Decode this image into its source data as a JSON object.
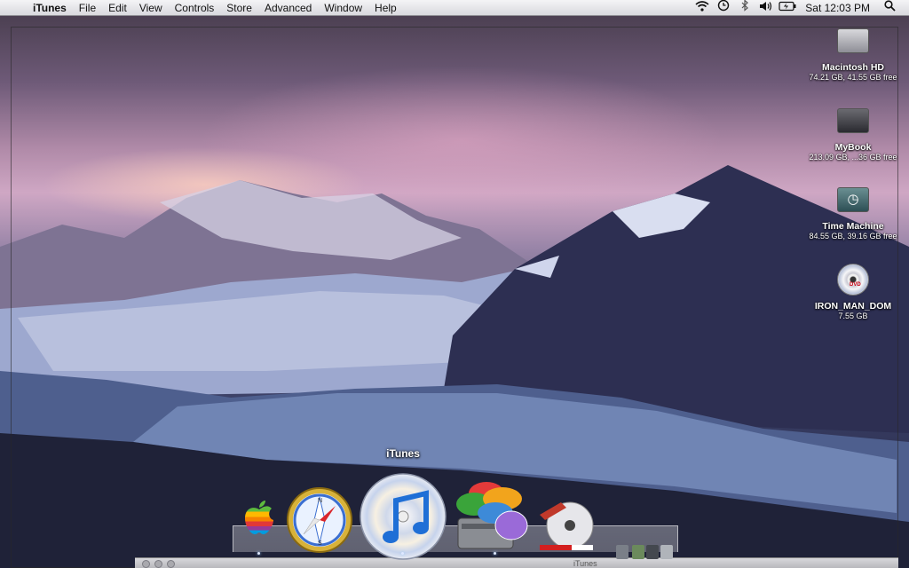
{
  "menubar": {
    "apple_glyph": "",
    "items": [
      "iTunes",
      "File",
      "Edit",
      "View",
      "Controls",
      "Store",
      "Advanced",
      "Window",
      "Help"
    ],
    "status_icons": [
      "wifi-icon",
      "time-machine-icon",
      "bluetooth-icon",
      "volume-icon",
      "battery-icon"
    ],
    "clock": "Sat 12:03 PM",
    "spotlight_glyph": "⌕"
  },
  "desktop_icons": [
    {
      "name": "Macintosh HD",
      "info": "74.21 GB, 41.55 GB free"
    },
    {
      "name": "MyBook",
      "info": "213.09 GB, ...36 GB free"
    },
    {
      "name": "Time Machine",
      "info": "84.55 GB, 39.16 GB free"
    },
    {
      "name": "IRON_MAN_DOM",
      "info": "7.55 GB"
    }
  ],
  "dock": {
    "hover_label": "iTunes",
    "apps": [
      "apple-icon",
      "safari-icon",
      "itunes-icon",
      "front-row-icon",
      "dvd-player-icon"
    ]
  },
  "window_strip": {
    "title": "iTunes"
  },
  "colors": {
    "menubar": "#e8e8ec",
    "sky": "#cfa7c4",
    "mountains": "#2a2c4a",
    "glacier": "#a9b6d8"
  }
}
